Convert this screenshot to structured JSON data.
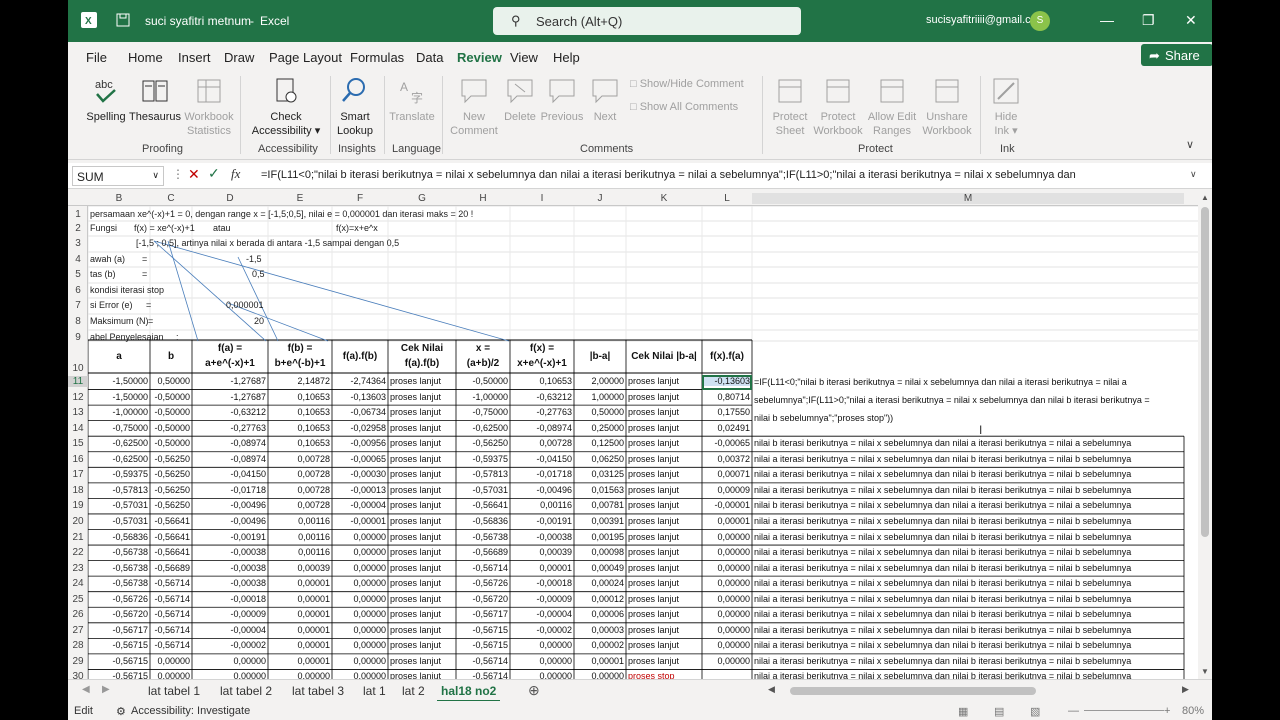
{
  "title": {
    "filename": "suci syafitri metnum",
    "sep": " - ",
    "app": "Excel",
    "search": "Search (Alt+Q)",
    "user": "sucisyafitriiii@gmail.com",
    "avatar": "S"
  },
  "menu": [
    "File",
    "Home",
    "Insert",
    "Draw",
    "Page Layout",
    "Formulas",
    "Data",
    "Review",
    "View",
    "Help"
  ],
  "share": "Share",
  "ribbon": {
    "spelling": "Spelling",
    "thesaurus": "Thesaurus",
    "wbstats1": "Workbook",
    "wbstats2": "Statistics",
    "proofing": "Proofing",
    "check1": "Check",
    "check2": "Accessibility",
    "accessibility": "Accessibility",
    "smart1": "Smart",
    "smart2": "Lookup",
    "insights": "Insights",
    "translate": "Translate",
    "language": "Language",
    "new1": "New",
    "new2": "Comment",
    "delete": "Delete",
    "previous": "Previous",
    "next": "Next",
    "showhide": "Show/Hide Comment",
    "showall": "Show All Comments",
    "comments": "Comments",
    "psheet1": "Protect",
    "psheet2": "Sheet",
    "pwb1": "Protect",
    "pwb2": "Workbook",
    "allow1": "Allow Edit",
    "allow2": "Ranges",
    "unshare1": "Unshare",
    "unshare2": "Workbook",
    "protect": "Protect",
    "hide1": "Hide",
    "hide2": "Ink",
    "ink": "Ink"
  },
  "namebox": "SUM",
  "formula": "=IF(L11<0;\"nilai b iterasi berikutnya = nilai x sebelumnya dan nilai a iterasi berikutnya = nilai a sebelumnya\";IF(L11>0;\"nilai a iterasi berikutnya = nilai x sebelumnya dan",
  "columns": [
    "B",
    "C",
    "D",
    "E",
    "F",
    "G",
    "H",
    "I",
    "J",
    "K",
    "L",
    "M"
  ],
  "info": {
    "r1": "persamaan xe^(-x)+1 = 0, dengan range x = [-1,5;0,5], nilai e = 0,000001 dan iterasi maks = 20 !",
    "fungsi": "Fungsi",
    "fx": "f(x) = xe^(-x)+1",
    "atau": "atau",
    "fx2": "f(x)=x+e^x",
    "r3": "[-1,5 ; 0,5], artinya nilai x berada di antara -1,5 sampai dengan 0,5",
    "bawah": "awah (a)",
    "eq1": "=",
    "bawahv": "-1,5",
    "atas": "tas (b)",
    "eq2": "=",
    "atasv": "0,5",
    "kondisi": "kondisi iterasi stop",
    "error": "si Error (e)",
    "eq3": "=",
    "errorv": "0,000001",
    "maks": "Maksimum (N)",
    "eq4": "=",
    "maksv": "20",
    "tabel": "abel Penyelesaian",
    "colon": ":"
  },
  "headers": [
    [
      "a",
      ""
    ],
    [
      "b",
      ""
    ],
    [
      "f(a) =",
      "a+e^(-x)+1"
    ],
    [
      "f(b) =",
      "b+e^(-b)+1"
    ],
    [
      "f(a).f(b)",
      ""
    ],
    [
      "Cek Nilai",
      "f(a).f(b)"
    ],
    [
      "x =",
      "(a+b)/2"
    ],
    [
      "f(x) =",
      "x+e^(-x)+1"
    ],
    [
      "|b-a|",
      ""
    ],
    [
      "Cek Nilai |b-a|",
      ""
    ],
    [
      "f(x).f(a)",
      ""
    ]
  ],
  "rows": [
    [
      "-1,50000",
      "0,50000",
      "-1,27687",
      "2,14872",
      "-2,74364",
      "proses lanjut",
      "-0,50000",
      "0,10653",
      "2,00000",
      "proses lanjut",
      "-0,13603"
    ],
    [
      "-1,50000",
      "-0,50000",
      "-1,27687",
      "0,10653",
      "-0,13603",
      "proses lanjut",
      "-1,00000",
      "-0,63212",
      "1,00000",
      "proses lanjut",
      "0,80714"
    ],
    [
      "-1,00000",
      "-0,50000",
      "-0,63212",
      "0,10653",
      "-0,06734",
      "proses lanjut",
      "-0,75000",
      "-0,27763",
      "0,50000",
      "proses lanjut",
      "0,17550"
    ],
    [
      "-0,75000",
      "-0,50000",
      "-0,27763",
      "0,10653",
      "-0,02958",
      "proses lanjut",
      "-0,62500",
      "-0,08974",
      "0,25000",
      "proses lanjut",
      "0,02491"
    ],
    [
      "-0,62500",
      "-0,50000",
      "-0,08974",
      "0,10653",
      "-0,00956",
      "proses lanjut",
      "-0,56250",
      "0,00728",
      "0,12500",
      "proses lanjut",
      "-0,00065"
    ],
    [
      "-0,62500",
      "-0,56250",
      "-0,08974",
      "0,00728",
      "-0,00065",
      "proses lanjut",
      "-0,59375",
      "-0,04150",
      "0,06250",
      "proses lanjut",
      "0,00372"
    ],
    [
      "-0,59375",
      "-0,56250",
      "-0,04150",
      "0,00728",
      "-0,00030",
      "proses lanjut",
      "-0,57813",
      "-0,01718",
      "0,03125",
      "proses lanjut",
      "0,00071"
    ],
    [
      "-0,57813",
      "-0,56250",
      "-0,01718",
      "0,00728",
      "-0,00013",
      "proses lanjut",
      "-0,57031",
      "-0,00496",
      "0,01563",
      "proses lanjut",
      "0,00009"
    ],
    [
      "-0,57031",
      "-0,56250",
      "-0,00496",
      "0,00728",
      "-0,00004",
      "proses lanjut",
      "-0,56641",
      "0,00116",
      "0,00781",
      "proses lanjut",
      "-0,00001"
    ],
    [
      "-0,57031",
      "-0,56641",
      "-0,00496",
      "0,00116",
      "-0,00001",
      "proses lanjut",
      "-0,56836",
      "-0,00191",
      "0,00391",
      "proses lanjut",
      "0,00001"
    ],
    [
      "-0,56836",
      "-0,56641",
      "-0,00191",
      "0,00116",
      "0,00000",
      "proses lanjut",
      "-0,56738",
      "-0,00038",
      "0,00195",
      "proses lanjut",
      "0,00000"
    ],
    [
      "-0,56738",
      "-0,56641",
      "-0,00038",
      "0,00116",
      "0,00000",
      "proses lanjut",
      "-0,56689",
      "0,00039",
      "0,00098",
      "proses lanjut",
      "0,00000"
    ],
    [
      "-0,56738",
      "-0,56689",
      "-0,00038",
      "0,00039",
      "0,00000",
      "proses lanjut",
      "-0,56714",
      "0,00001",
      "0,00049",
      "proses lanjut",
      "0,00000"
    ],
    [
      "-0,56738",
      "-0,56714",
      "-0,00038",
      "0,00001",
      "0,00000",
      "proses lanjut",
      "-0,56726",
      "-0,00018",
      "0,00024",
      "proses lanjut",
      "0,00000"
    ],
    [
      "-0,56726",
      "-0,56714",
      "-0,00018",
      "0,00001",
      "0,00000",
      "proses lanjut",
      "-0,56720",
      "-0,00009",
      "0,00012",
      "proses lanjut",
      "0,00000"
    ],
    [
      "-0,56720",
      "-0,56714",
      "-0,00009",
      "0,00001",
      "0,00000",
      "proses lanjut",
      "-0,56717",
      "-0,00004",
      "0,00006",
      "proses lanjut",
      "0,00000"
    ],
    [
      "-0,56717",
      "-0,56714",
      "-0,00004",
      "0,00001",
      "0,00000",
      "proses lanjut",
      "-0,56715",
      "-0,00002",
      "0,00003",
      "proses lanjut",
      "0,00000"
    ],
    [
      "-0,56715",
      "-0,56714",
      "-0,00002",
      "0,00001",
      "0,00000",
      "proses lanjut",
      "-0,56715",
      "0,00000",
      "0,00002",
      "proses lanjut",
      "0,00000"
    ],
    [
      "-0,56715",
      "0,00000",
      "0,00000",
      "0,00001",
      "0,00000",
      "proses lanjut",
      "-0,56714",
      "0,00000",
      "0,00001",
      "proses lanjut",
      "0,00000"
    ],
    [
      "-0,56715",
      "0,00000",
      "0,00000",
      "0,00000",
      "0,00000",
      "proses lanjut",
      "-0,56714",
      "0,00000",
      "0,00000",
      "proses stop",
      ""
    ]
  ],
  "edit": {
    "l1": "=IF(L11<0;\"nilai b iterasi berikutnya = nilai x sebelumnya dan nilai a iterasi berikutnya = nilai a",
    "l2": "sebelumnya\";IF(L11>0;\"nilai a iterasi berikutnya = nilai x sebelumnya dan nilai b iterasi berikutnya =",
    "l3": "nilai b sebelumnya\";\"proses stop\"))"
  },
  "mvals": [
    "nilai b iterasi berikutnya = nilai x sebelumnya dan nilai a iterasi berikutnya = nilai a sebelumnya",
    "nilai a iterasi berikutnya = nilai x sebelumnya dan nilai b iterasi berikutnya = nilai b sebelumnya",
    "nilai a iterasi berikutnya = nilai x sebelumnya dan nilai b iterasi berikutnya = nilai b sebelumnya",
    "nilai a iterasi berikutnya = nilai x sebelumnya dan nilai b iterasi berikutnya = nilai b sebelumnya",
    "nilai b iterasi berikutnya = nilai x sebelumnya dan nilai a iterasi berikutnya = nilai a sebelumnya",
    "nilai a iterasi berikutnya = nilai x sebelumnya dan nilai b iterasi berikutnya = nilai b sebelumnya",
    "nilai a iterasi berikutnya = nilai x sebelumnya dan nilai b iterasi berikutnya = nilai b sebelumnya",
    "nilai a iterasi berikutnya = nilai x sebelumnya dan nilai b iterasi berikutnya = nilai b sebelumnya",
    "nilai a iterasi berikutnya = nilai x sebelumnya dan nilai b iterasi berikutnya = nilai b sebelumnya",
    "nilai a iterasi berikutnya = nilai x sebelumnya dan nilai b iterasi berikutnya = nilai b sebelumnya",
    "nilai a iterasi berikutnya = nilai x sebelumnya dan nilai b iterasi berikutnya = nilai b sebelumnya",
    "nilai a iterasi berikutnya = nilai x sebelumnya dan nilai b iterasi berikutnya = nilai b sebelumnya",
    "nilai a iterasi berikutnya = nilai x sebelumnya dan nilai b iterasi berikutnya = nilai b sebelumnya",
    "nilai a iterasi berikutnya = nilai x sebelumnya dan nilai b iterasi berikutnya = nilai b sebelumnya",
    "nilai a iterasi berikutnya = nilai x sebelumnya dan nilai b iterasi berikutnya = nilai b sebelumnya",
    "nilai a iterasi berikutnya = nilai x sebelumnya dan nilai b iterasi berikutnya = nilai b sebelumnya"
  ],
  "tabs": [
    "lat tabel 1",
    "lat tabel 2",
    "lat tabel 3",
    "lat 1",
    "lat 2",
    "hal18 no2"
  ],
  "status": {
    "mode": "Edit",
    "acc": "Accessibility: Investigate",
    "zoom": "80%"
  },
  "colors": {
    "brand": "#217346",
    "red": "#c00000"
  }
}
